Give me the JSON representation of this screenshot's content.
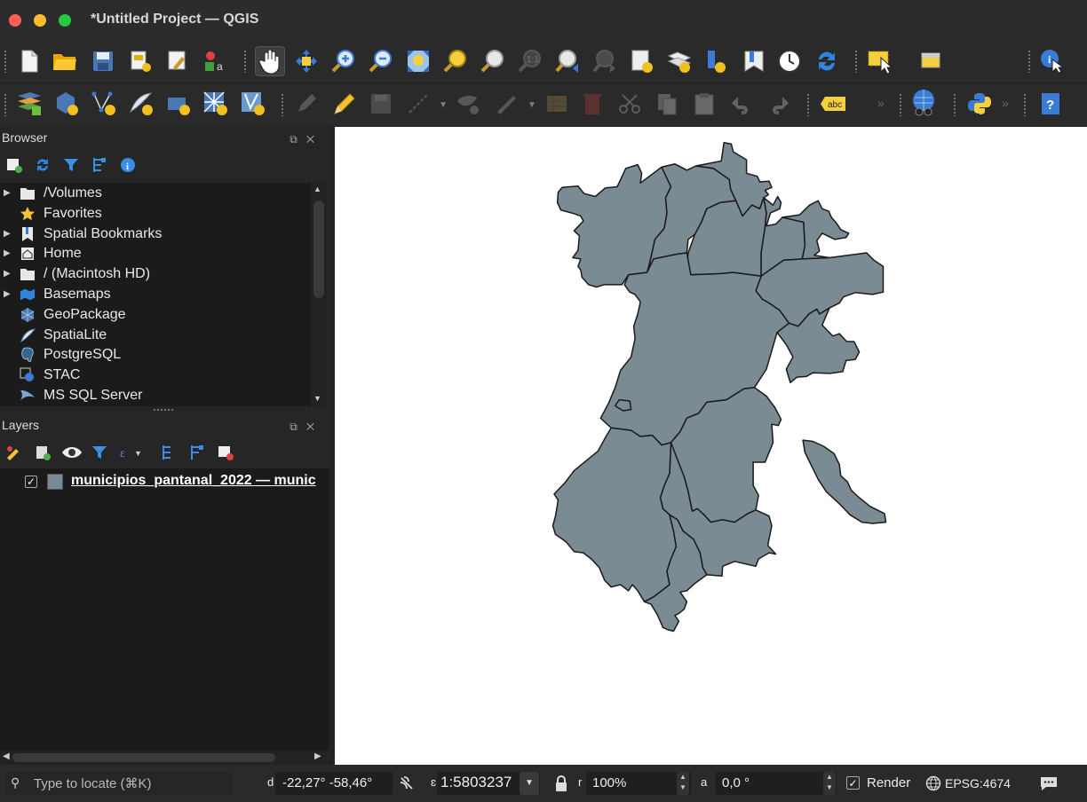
{
  "window": {
    "title": "*Untitled Project — QGIS"
  },
  "colors": {
    "polygon_fill": "#7b8b94",
    "polygon_stroke": "#1a1a1a",
    "map_background": "#ffffff"
  },
  "toolbar1": {
    "icons": [
      "new-project-icon",
      "open-project-icon",
      "save-project-icon",
      "print-layout-icon",
      "layout-manager-icon",
      "style-manager-icon",
      "pan-icon",
      "pan-to-selection-icon",
      "zoom-in-icon",
      "zoom-out-icon",
      "zoom-full-icon",
      "zoom-to-selection-icon",
      "zoom-to-layer-icon",
      "zoom-native-icon",
      "zoom-last-icon",
      "zoom-next-icon",
      "new-bookmark-icon",
      "show-bookmarks-icon",
      "new-spatial-bookmark-icon",
      "show-spatial-bookmarks-icon",
      "temporal-controller-icon",
      "refresh-icon",
      "select-features-icon",
      "open-attribute-table-icon",
      "identify-features-icon"
    ]
  },
  "toolbar2": {
    "icons": [
      "data-source-manager-icon",
      "new-geopackage-layer-icon",
      "new-shapefile-layer-icon",
      "new-spatialite-layer-icon",
      "new-temporary-layer-icon",
      "new-virtual-layer-icon",
      "new-mesh-layer-icon",
      "current-edits-icon",
      "toggle-editing-icon",
      "save-edits-icon",
      "digitize-icon",
      "vertex-tool-icon",
      "modify-attributes-icon",
      "delete-selected-icon",
      "cut-features-icon",
      "copy-features-icon",
      "paste-features-icon",
      "undo-icon",
      "redo-icon",
      "label-abc-icon",
      "georeferencer-icon",
      "python-console-icon",
      "help-icon"
    ]
  },
  "browser": {
    "title": "Browser",
    "items": [
      {
        "label": "/Volumes",
        "icon": "folder-icon",
        "expandable": true
      },
      {
        "label": "Favorites",
        "icon": "star-icon",
        "expandable": false
      },
      {
        "label": "Spatial Bookmarks",
        "icon": "bookmark-icon",
        "expandable": true
      },
      {
        "label": "Home",
        "icon": "home-icon",
        "expandable": true
      },
      {
        "label": "/ (Macintosh HD)",
        "icon": "folder-icon",
        "expandable": true
      },
      {
        "label": "Basemaps",
        "icon": "basemaps-icon",
        "expandable": true
      },
      {
        "label": "GeoPackage",
        "icon": "geopackage-icon",
        "expandable": false
      },
      {
        "label": "SpatiaLite",
        "icon": "spatialite-icon",
        "expandable": false
      },
      {
        "label": "PostgreSQL",
        "icon": "postgresql-icon",
        "expandable": false
      },
      {
        "label": "STAC",
        "icon": "stac-icon",
        "expandable": false
      },
      {
        "label": "MS SQL Server",
        "icon": "mssql-icon",
        "expandable": false
      }
    ]
  },
  "layers": {
    "title": "Layers",
    "items": [
      {
        "name": "municipios_pantanal_2022 — munic",
        "checked": true
      }
    ]
  },
  "statusbar": {
    "locate_placeholder": "Type to locate (⌘K)",
    "coordinate_prefix": "d",
    "coordinate": "-22,27°  -58,46°",
    "scale_prefix": "ɛ",
    "scale": "1:5803237",
    "magnifier_prefix": "r",
    "magnifier": "100%",
    "rotation_prefix": "a",
    "rotation": "0,0 °",
    "render_label": "Render",
    "render_checked": true,
    "crs": "EPSG:4674"
  }
}
